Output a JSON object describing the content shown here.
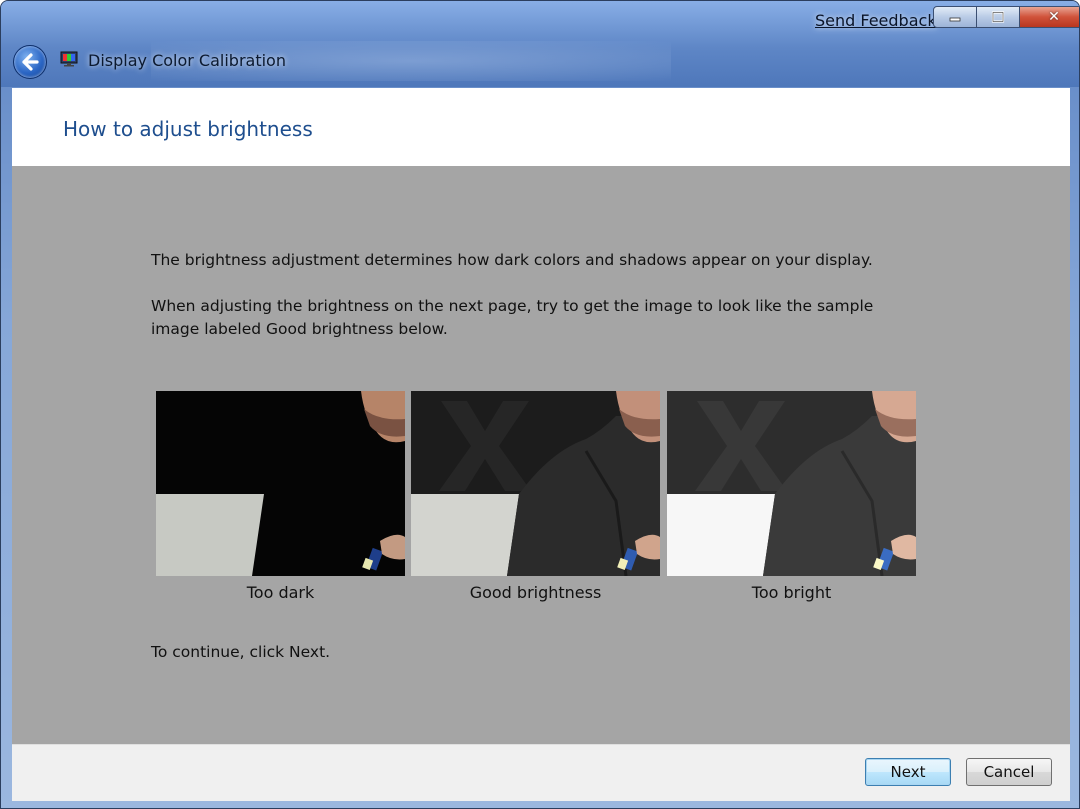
{
  "window": {
    "title": "Display Color Calibration",
    "feedback_link": "Send Feedback",
    "controls": {
      "minimize": "minimize",
      "maximize": "maximize",
      "close": "close"
    }
  },
  "header": {
    "title": "How to adjust brightness"
  },
  "content": {
    "intro": "The brightness adjustment determines how dark colors and shadows appear on your display.",
    "instruction_line1": "When adjusting the brightness on the next page, try to get the image to look like the sample",
    "instruction_line2": "image labeled Good brightness below.",
    "samples": [
      {
        "label": "Too dark"
      },
      {
        "label": "Good brightness"
      },
      {
        "label": "Too bright"
      }
    ],
    "continue_text": "To continue, click Next."
  },
  "footer": {
    "next_label": "Next",
    "cancel_label": "Cancel"
  },
  "colors": {
    "title_blue": "#1e4e8e",
    "content_gray": "#a5a5a5",
    "footer_gray": "#f0f0f0"
  }
}
